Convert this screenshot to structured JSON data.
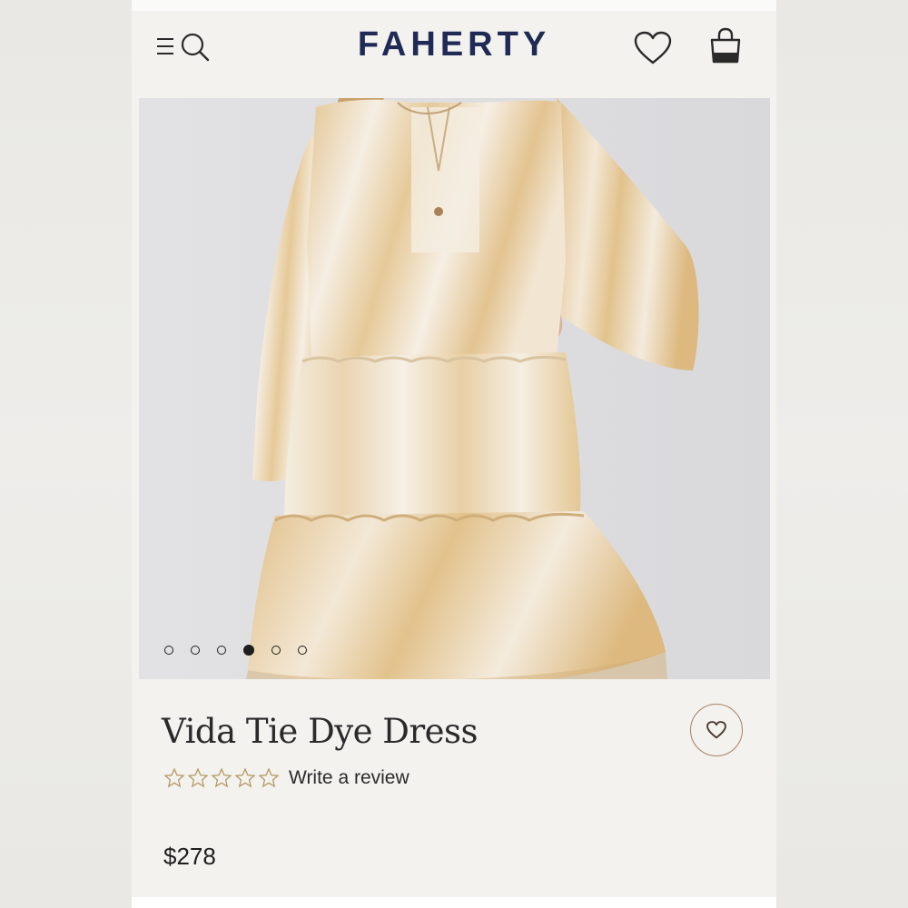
{
  "header": {
    "brand": "FAHERTY",
    "menu_icon": "menu-icon",
    "search_icon": "search-icon",
    "wishlist_icon": "heart-icon",
    "bag_icon": "shopping-bag-icon"
  },
  "carousel": {
    "image_alt": "Vida Tie Dye Dress product photo",
    "slide_count": 6,
    "active_slide": 4
  },
  "product": {
    "title": "Vida Tie Dye Dress",
    "rating_stars": 5,
    "rating_value": 0,
    "review_link": "Write a review",
    "price": "$278"
  },
  "colors": {
    "brand_navy": "#1f2a55",
    "accent_brown": "#a97f64",
    "star_gold": "#b59a63",
    "dress_tan": "#e2c28f",
    "dress_cream": "#f4ece0"
  }
}
